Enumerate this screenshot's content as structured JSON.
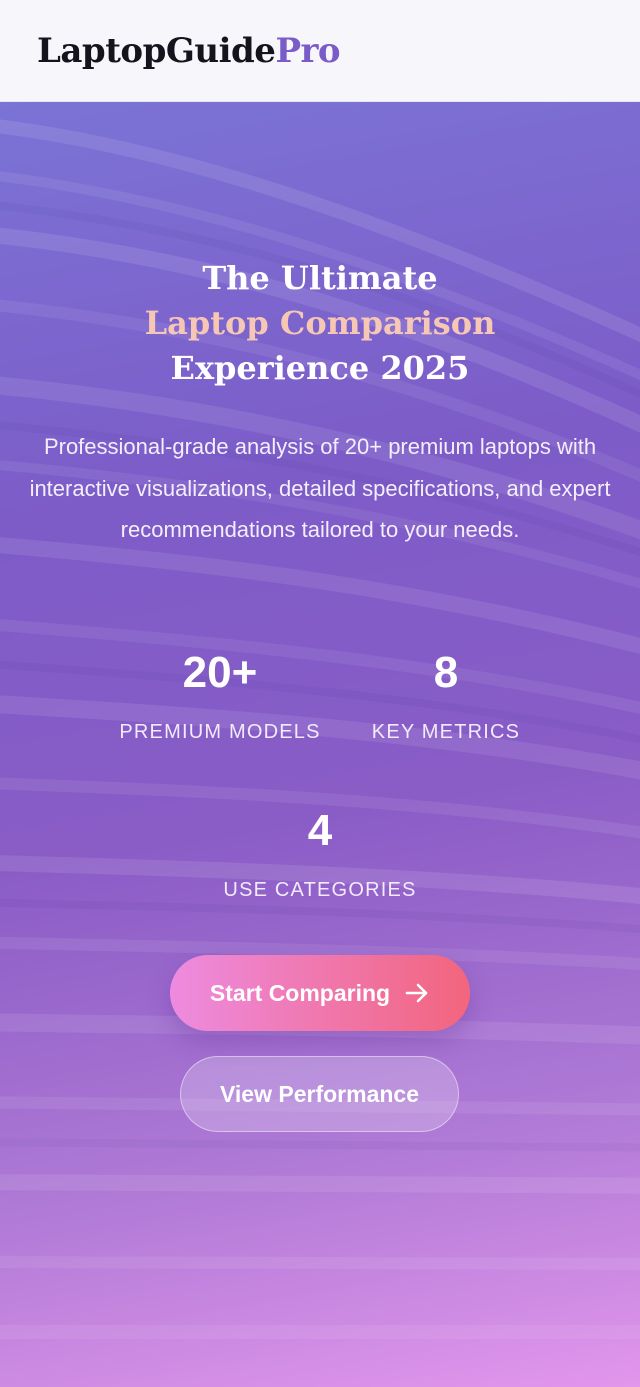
{
  "header": {
    "logo_main": "LaptopGuide",
    "logo_accent": "Pro"
  },
  "hero": {
    "title_line1": "The Ultimate",
    "title_highlight": "Laptop Comparison",
    "title_line3": "Experience 2025",
    "subtitle": "Professional-grade analysis of 20+ premium laptops with interactive visualizations, detailed specifications, and expert recommendations tailored to your needs.",
    "stats": [
      {
        "value": "20+",
        "label": "PREMIUM MODELS"
      },
      {
        "value": "8",
        "label": "KEY METRICS"
      },
      {
        "value": "4",
        "label": "USE CATEGORIES"
      }
    ],
    "primary_button": "Start Comparing",
    "primary_button_icon": "arrow-right-icon",
    "secondary_button": "View Performance"
  },
  "colors": {
    "brand_accent": "#7a5cc9",
    "title_highlight": "#f6c7b4",
    "primary_button_start": "#ee8be0",
    "primary_button_end": "#f3657d"
  }
}
